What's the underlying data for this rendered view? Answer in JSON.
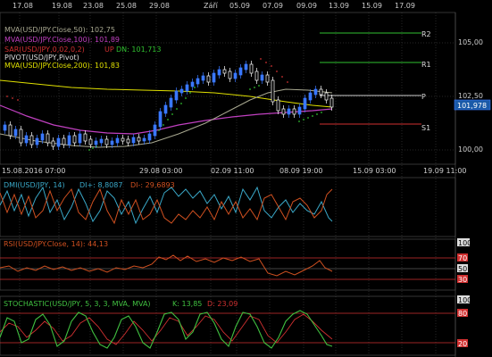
{
  "top_axis": {
    "labels": [
      "17.08",
      "19.08",
      "23.08",
      "25.08",
      "29.08",
      "Září",
      "05.09",
      "07.09",
      "09.09",
      "13.09",
      "15.09",
      "17.09"
    ]
  },
  "main_panel": {
    "legend": [
      {
        "text": "MVA(USD/JPY.Close,50): 102,75",
        "color": "#b0b0b0"
      },
      {
        "text": "MVA(USD/JPY.Close,100): 101,89",
        "color": "#c040c0"
      },
      {
        "text": "SAR(USD/JPY,0,02,0,2)",
        "color": "#d03030"
      },
      {
        "text": "UP",
        "color": "#d03030"
      },
      {
        "text": "DN: 101,713",
        "color": "#30c030"
      },
      {
        "text": "PIVOT(USD/JPY,Pivot)",
        "color": "#dddddd"
      },
      {
        "text": "MVA(USD/JPY.Close,200): 101,83",
        "color": "#e0e000"
      }
    ],
    "pivot_labels": [
      "R2",
      "R1",
      "P",
      "S1"
    ],
    "price_axis": [
      "105,00",
      "102,50",
      "100,00"
    ],
    "current_price": "101,978",
    "bottom_axis": [
      "15.08.2016 07:00",
      "29.08 03:00",
      "02.09 11:00",
      "08.09 19:00",
      "15.09 03:00",
      "19.09 11:00"
    ]
  },
  "dmi_panel": {
    "label_name": "DMI(USD/JPY, 14)",
    "label_di_plus": "DI+: 8,8087",
    "label_di_minus": "DI-: 29,6893"
  },
  "rsi_panel": {
    "label": "RSI(USD/JPY.Close, 14): 44,13",
    "axis": [
      "100",
      "70",
      "50",
      "30"
    ]
  },
  "stoch_panel": {
    "label_main": "STOCHASTIC(USD/JPY, 5, 3, 3, MVA, MVA)",
    "label_k": "K: 13,85",
    "label_d": "D: 23,09",
    "axis": [
      "100",
      "80",
      "20"
    ]
  },
  "colors": {
    "bg": "#000000",
    "grid": "#2a2a2a",
    "axis_text": "#cccccc",
    "bull": "#3a78ff",
    "bear": "#ffffff",
    "mva50": "#a8a890",
    "mva100": "#c040c0",
    "mva200": "#e0e000",
    "sar_up": "#d03030",
    "sar_dn": "#30c030",
    "pivot_r": "#30c030",
    "pivot_s": "#d03030",
    "pivot_p": "#cccccc",
    "dmi_plus": "#3aa8c8",
    "dmi_minus": "#d05020",
    "rsi": "#d05020",
    "stoch_k": "#40c040",
    "stoch_d": "#d03030",
    "band": "#d03030"
  }
}
